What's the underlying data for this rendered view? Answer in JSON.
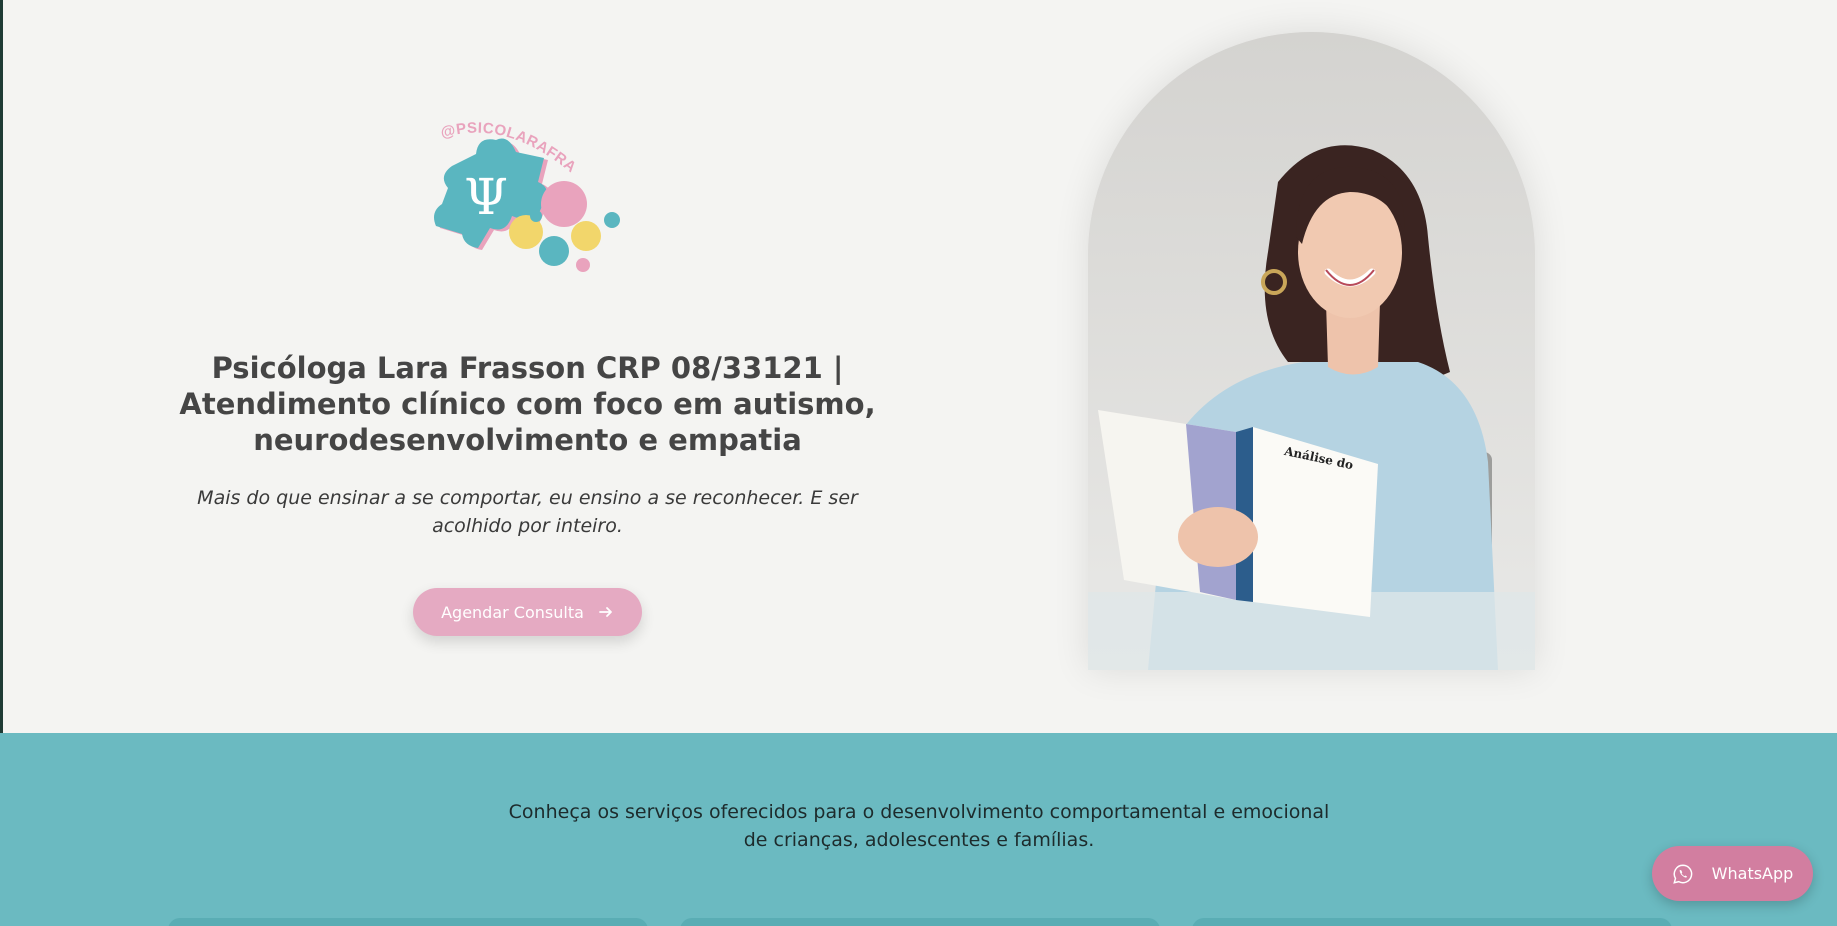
{
  "brand": {
    "handle": "@PSICOLARAFRASSON",
    "symbol": "Ψ"
  },
  "hero": {
    "title": "Psicóloga Lara Frasson CRP 08/33121 | Atendimento clínico com foco em autismo, neurodesenvolvimento e empatia",
    "subtitle": "Mais do que ensinar a se comportar, eu ensino a se reconhecer. E ser acolhido por inteiro.",
    "cta_label": "Agendar Consulta",
    "book_title": "Análise do Comportamento Aplicada ao Transtorno do Espectro Autista"
  },
  "services": {
    "intro": "Conheça os serviços oferecidos para o desenvolvimento comportamental e emocional de crianças, adolescentes e famílias."
  },
  "whatsapp": {
    "label": "WhatsApp"
  },
  "colors": {
    "teal": "#6bbac1",
    "pink": "#e5aac2",
    "yellow": "#f2d66b",
    "background": "#f4f4f2"
  },
  "icons": {
    "cta": "arrow-right-icon",
    "whatsapp": "whatsapp-icon"
  }
}
